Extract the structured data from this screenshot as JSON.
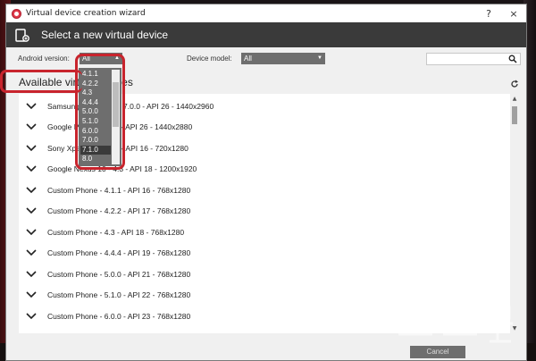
{
  "window": {
    "title": "Virtual device creation wizard",
    "help": "?",
    "close": "×"
  },
  "header": {
    "title": "Select a new virtual device"
  },
  "filters": {
    "android_label": "Android version:",
    "android_value": "All",
    "model_label": "Device model:",
    "model_value": "All",
    "search_value": ""
  },
  "android_dropdown": {
    "options": [
      "4.1.1",
      "4.2.2",
      "4.3",
      "4.4.4",
      "5.0.0",
      "5.1.0",
      "6.0.0",
      "7.0.0",
      "7.1.0",
      "8.0"
    ],
    "selected": "7.1.0"
  },
  "section": {
    "title": "Available virtual devices"
  },
  "devices": [
    "Samsung Galaxy S8 - 7.0.0 - API 26 - 1440x2960",
    "Google Pixel XL - 8.0 - API 26 - 1440x2880",
    "Sony Xperia Z - 4.1.1 - API 16 - 720x1280",
    "Google Nexus 10 - 4.3 - API 18 - 1200x1920",
    "Custom Phone - 4.1.1 - API 16 - 768x1280",
    "Custom Phone - 4.2.2 - API 17 - 768x1280",
    "Custom Phone - 4.3 - API 18 - 768x1280",
    "Custom Phone - 4.4.4 - API 19 - 768x1280",
    "Custom Phone - 5.0.0 - API 21 - 768x1280",
    "Custom Phone - 5.1.0 - API 22 - 768x1280",
    "Custom Phone - 6.0.0 - API 23 - 768x1280"
  ],
  "footer": {
    "cancel_label": "Cancel"
  },
  "colors": {
    "accent_red": "#c8242d",
    "header_bg": "#3a3a3a",
    "control_bg": "#6e6e6e"
  },
  "icons": [
    "app-icon",
    "device-icon",
    "search-icon",
    "refresh-icon",
    "chevron-down-icon"
  ]
}
